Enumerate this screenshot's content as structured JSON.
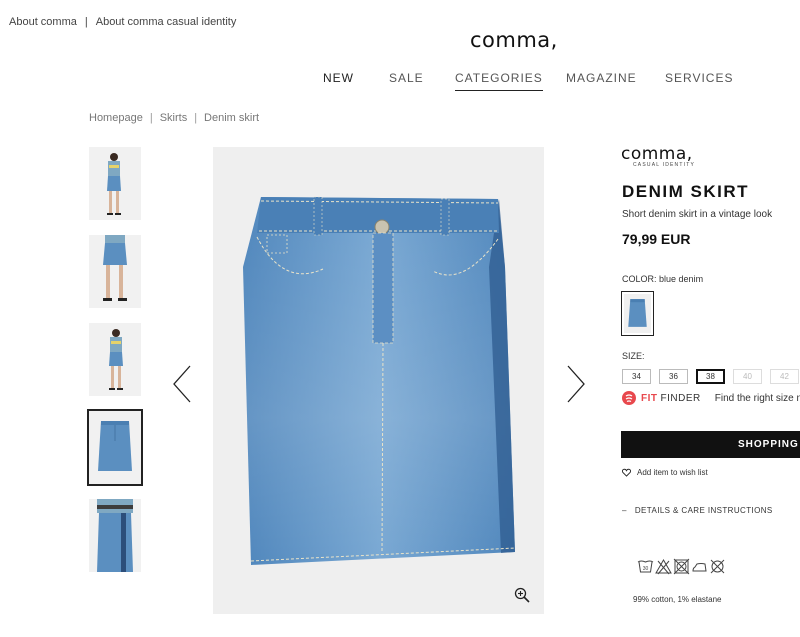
{
  "top_links": [
    "About comma",
    "About comma casual identity"
  ],
  "logo": "comma,",
  "nav": [
    {
      "label": "NEW"
    },
    {
      "label": "SALE"
    },
    {
      "label": "CATEGORIES"
    },
    {
      "label": "MAGAZINE"
    },
    {
      "label": "SERVICES"
    }
  ],
  "breadcrumb": [
    "Homepage",
    "Skirts",
    "Denim skirt"
  ],
  "product": {
    "brand": "comma,",
    "brand_sub": "CASUAL IDENTITY",
    "title": "DENIM SKIRT",
    "subtitle": "Short denim skirt in a vintage look",
    "price": "79,99 EUR",
    "color_label": "COLOR:",
    "color_value": "blue denim",
    "size_label": "SIZE:",
    "sizes": [
      "34",
      "36",
      "38",
      "40",
      "42"
    ],
    "selected_size": "38",
    "fit_finder_brand": "FIT",
    "fit_finder_brand2": "FINDER",
    "fit_finder_text": "Find the right size no",
    "shopping_button": "SHOPPING",
    "wishlist": "Add item to wish list",
    "details": "DETAILS & CARE INSTRUCTIONS",
    "material": "99% cotton, 1% elastane",
    "wash_temp": "30"
  },
  "icons": [
    "arrow-left-icon",
    "arrow-right-icon",
    "zoom-icon",
    "heart-icon",
    "fit-finder-icon"
  ],
  "colors": {
    "accent": "#e8484d",
    "denim": "#5b8fc0",
    "button": "#111111"
  }
}
